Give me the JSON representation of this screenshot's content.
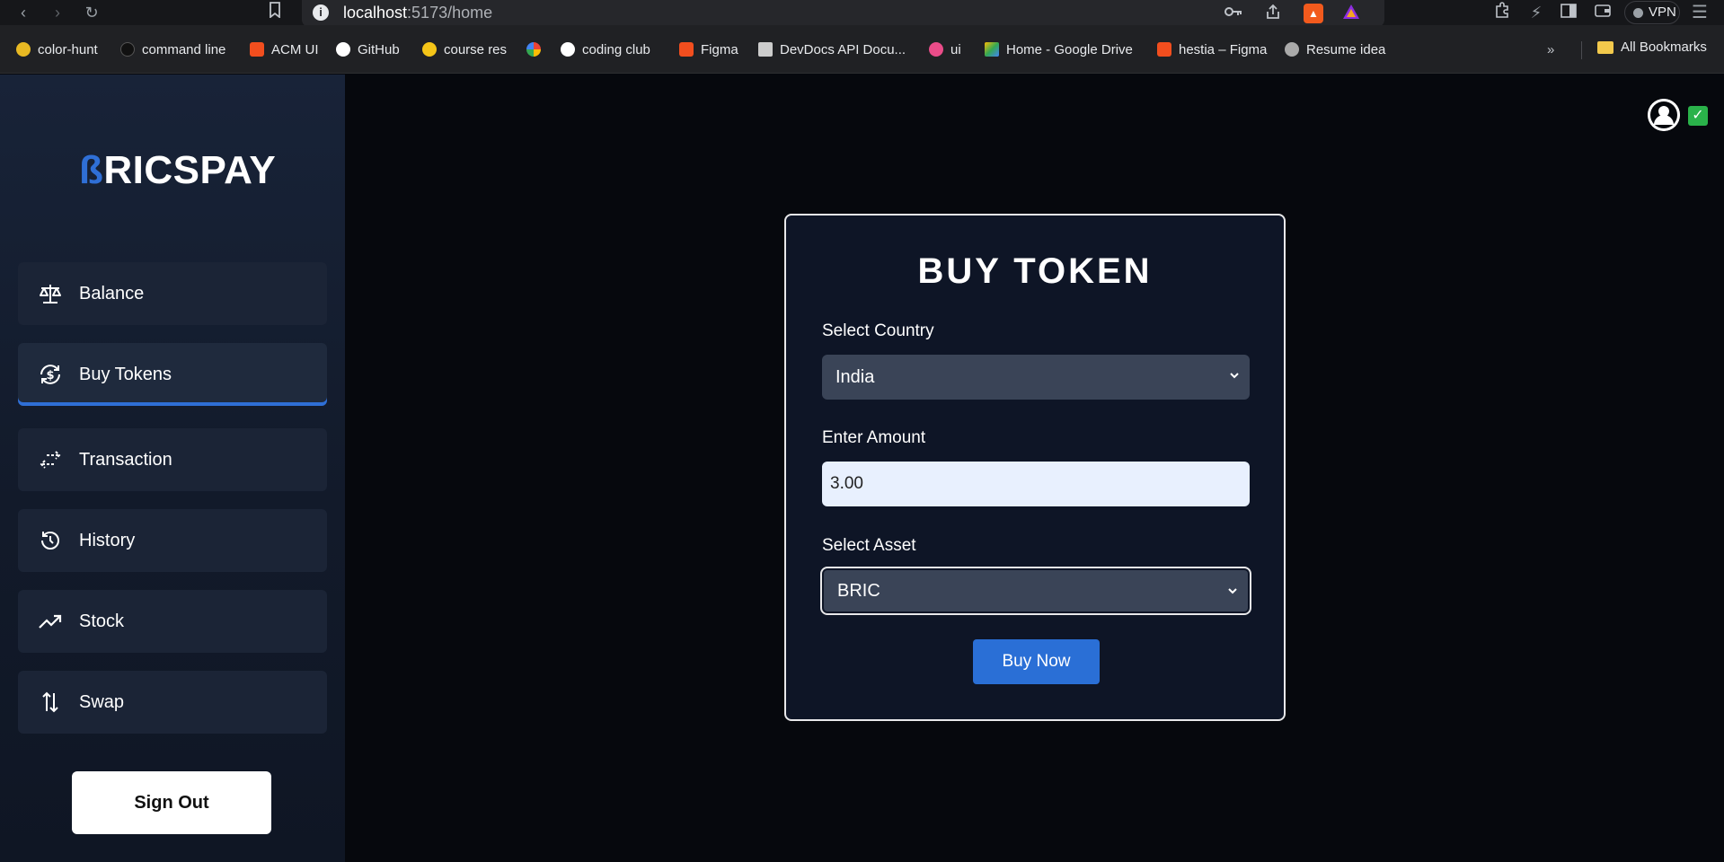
{
  "browser": {
    "url_host": "localhost",
    "url_path": ":5173/home",
    "vpn_label": "VPN",
    "bookmarks": [
      {
        "label": "color-hunt",
        "color": "#e8b923"
      },
      {
        "label": "command line",
        "color": "#111111"
      },
      {
        "label": "ACM UI",
        "color": "#f24e1e"
      },
      {
        "label": "GitHub",
        "color": "#ffffff"
      },
      {
        "label": "course res",
        "color": "#f5c518"
      },
      {
        "label": "",
        "color": "#4285f4"
      },
      {
        "label": "coding club",
        "color": "#ffffff"
      },
      {
        "label": "Figma",
        "color": "#f24e1e"
      },
      {
        "label": "DevDocs API Docu...",
        "color": "#cccccc"
      },
      {
        "label": "ui",
        "color": "#ea4c89"
      },
      {
        "label": "Home - Google Drive",
        "color": "#34a853"
      },
      {
        "label": "hestia – Figma",
        "color": "#f24e1e"
      },
      {
        "label": "Resume  idea",
        "color": "#aaaaaa"
      }
    ],
    "all_bookmarks": "All Bookmarks"
  },
  "app": {
    "logo_b": "ß",
    "logo_rest": "RICSPAY",
    "nav": [
      {
        "label": "Balance",
        "icon": "scale-icon"
      },
      {
        "label": "Buy Tokens",
        "icon": "dollar-refresh-icon"
      },
      {
        "label": "Transaction",
        "icon": "transfer-icon"
      },
      {
        "label": "History",
        "icon": "history-icon"
      },
      {
        "label": "Stock",
        "icon": "trending-up-icon"
      },
      {
        "label": "Swap",
        "icon": "swap-icon"
      }
    ],
    "signout_label": "Sign Out",
    "accent": "#2f6fd6"
  },
  "form": {
    "title": "BUY TOKEN",
    "country_label": "Select Country",
    "country_value": "India",
    "amount_label": "Enter Amount",
    "amount_value": "3.00",
    "asset_label": "Select Asset",
    "asset_value": "BRIC",
    "submit_label": "Buy Now"
  }
}
